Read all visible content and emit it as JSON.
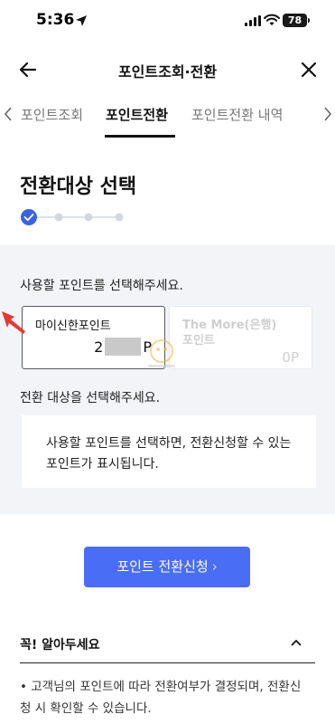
{
  "status_bar": {
    "time": "5:36",
    "battery": "78"
  },
  "header": {
    "title": "포인트조회·전환"
  },
  "tabs": [
    {
      "label": "포인트조회",
      "active": false
    },
    {
      "label": "포인트전환",
      "active": true
    },
    {
      "label": "포인트전환 내역",
      "active": false
    }
  ],
  "step": {
    "title": "전환대상 선택",
    "current": 1,
    "total": 4
  },
  "select_points": {
    "label": "사용할 포인트를 선택해주세요.",
    "cards": [
      {
        "title": "마이신한포인트",
        "value_prefix": "2",
        "value_suffix": "P",
        "selected": true
      },
      {
        "title": "The More(은행) 포인트",
        "value": "0P",
        "selected": false
      }
    ]
  },
  "target": {
    "label": "전환 대상을 선택해주세요.",
    "placeholder": "사용할 포인트를 선택하면, 전환신청할 수 있는 포인트가 표시됩니다."
  },
  "apply_button": {
    "label": "포인트 전환신청",
    "chevron": "›"
  },
  "notice": {
    "title": "꼭! 알아두세요",
    "body": "• 고객님의 포인트에 따라 전환여부가 결정되며, 전환신청 시 확인할 수 있습니다."
  },
  "colors": {
    "accent": "#4a6df5",
    "step_active": "#3a63e0",
    "section_bg": "#f2f4f7",
    "annotation_arrow": "#e53935"
  }
}
